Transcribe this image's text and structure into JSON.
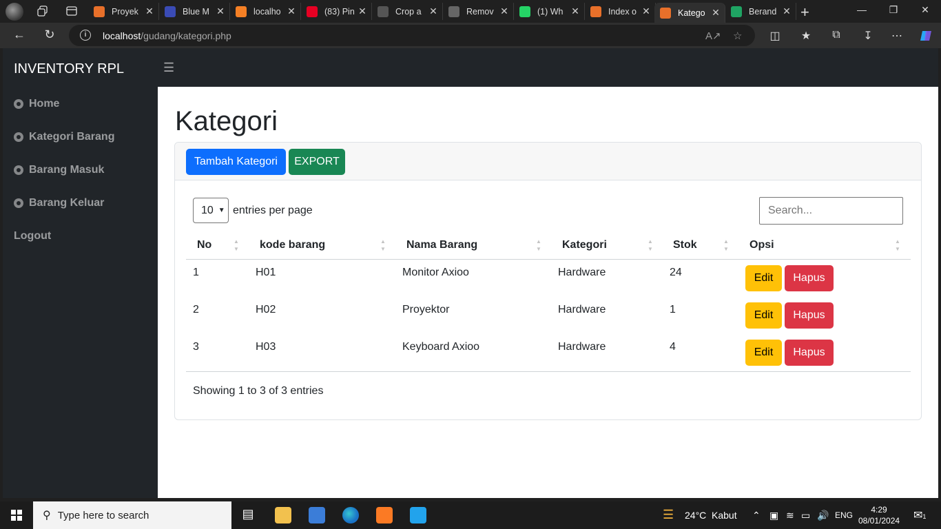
{
  "browser": {
    "tabs": [
      {
        "label": "Proyek",
        "color": "#e8702a",
        "active": false
      },
      {
        "label": "Blue M",
        "color": "#3a4bb5",
        "active": false
      },
      {
        "label": "localho",
        "color": "#f58025",
        "active": false
      },
      {
        "label": "(83) Pin",
        "color": "#e60023",
        "active": false
      },
      {
        "label": "Crop a",
        "color": "#555555",
        "active": false
      },
      {
        "label": "Remov",
        "color": "#666666",
        "active": false
      },
      {
        "label": "(1) Wh",
        "color": "#25d366",
        "active": false
      },
      {
        "label": "Index o",
        "color": "#e8702a",
        "active": false
      },
      {
        "label": "Katego",
        "color": "#e8702a",
        "active": true
      },
      {
        "label": "Berand",
        "color": "#1fa463",
        "active": false
      }
    ],
    "url_host": "localhost",
    "url_path": "/gudang/kategori.php"
  },
  "sidebar": {
    "brand": "INVENTORY RPL",
    "items": [
      {
        "label": "Home"
      },
      {
        "label": "Kategori Barang"
      },
      {
        "label": "Barang Masuk"
      },
      {
        "label": "Barang Keluar"
      }
    ],
    "logout": "Logout"
  },
  "main": {
    "title": "Kategori",
    "add_button": "Tambah Kategori",
    "export_button": "EXPORT",
    "entries_value": "10",
    "entries_label": "entries per page",
    "search_placeholder": "Search...",
    "columns": [
      "No",
      "kode barang",
      "Nama Barang",
      "Kategori",
      "Stok",
      "Opsi"
    ],
    "rows": [
      {
        "no": "1",
        "kode": "H01",
        "nama": "Monitor Axioo",
        "kategori": "Hardware",
        "stok": "24"
      },
      {
        "no": "2",
        "kode": "H02",
        "nama": "Proyektor",
        "kategori": "Hardware",
        "stok": "1"
      },
      {
        "no": "3",
        "kode": "H03",
        "nama": "Keyboard Axioo",
        "kategori": "Hardware",
        "stok": "4"
      }
    ],
    "edit_label": "Edit",
    "delete_label": "Hapus",
    "info": "Showing 1 to 3 of 3 entries"
  },
  "taskbar": {
    "search_placeholder": "Type here to search",
    "weather_temp": "24°C",
    "weather_text": "Kabut",
    "language": "ENG",
    "time": "4:29",
    "date": "08/01/2024",
    "notification_count": "1"
  }
}
